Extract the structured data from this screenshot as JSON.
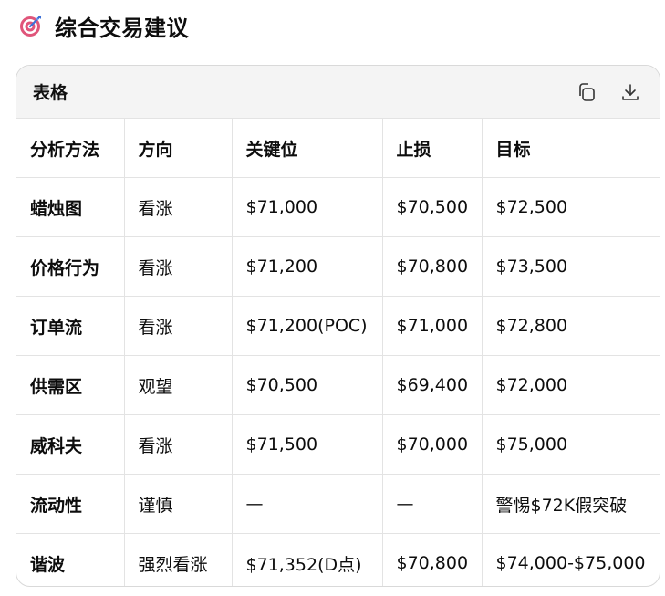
{
  "heading": {
    "icon": "direct-hit-target-icon",
    "title": "综合交易建议"
  },
  "table_card": {
    "title": "表格",
    "actions": {
      "copy_icon": "copy-icon",
      "download_icon": "download-icon"
    },
    "columns": [
      "分析方法",
      "方向",
      "关键位",
      "止损",
      "目标"
    ],
    "rows": [
      [
        "蜡烛图",
        "看涨",
        "$71,000",
        "$70,500",
        "$72,500"
      ],
      [
        "价格行为",
        "看涨",
        "$71,200",
        "$70,800",
        "$73,500"
      ],
      [
        "订单流",
        "看涨",
        "$71,200(POC)",
        "$71,000",
        "$72,800"
      ],
      [
        "供需区",
        "观望",
        "$70,500",
        "$69,400",
        "$72,000"
      ],
      [
        "威科夫",
        "看涨",
        "$71,500",
        "$70,000",
        "$75,000"
      ],
      [
        "流动性",
        "谨慎",
        "—",
        "—",
        "警惕$72K假突破"
      ],
      [
        "谐波",
        "强烈看涨",
        "$71,352(D点)",
        "$70,800",
        "$74,000-$75,000"
      ]
    ]
  },
  "colors": {
    "header_bg": "#f4f4f4",
    "border": "#e3e3e3",
    "text": "#0d0d0d"
  }
}
